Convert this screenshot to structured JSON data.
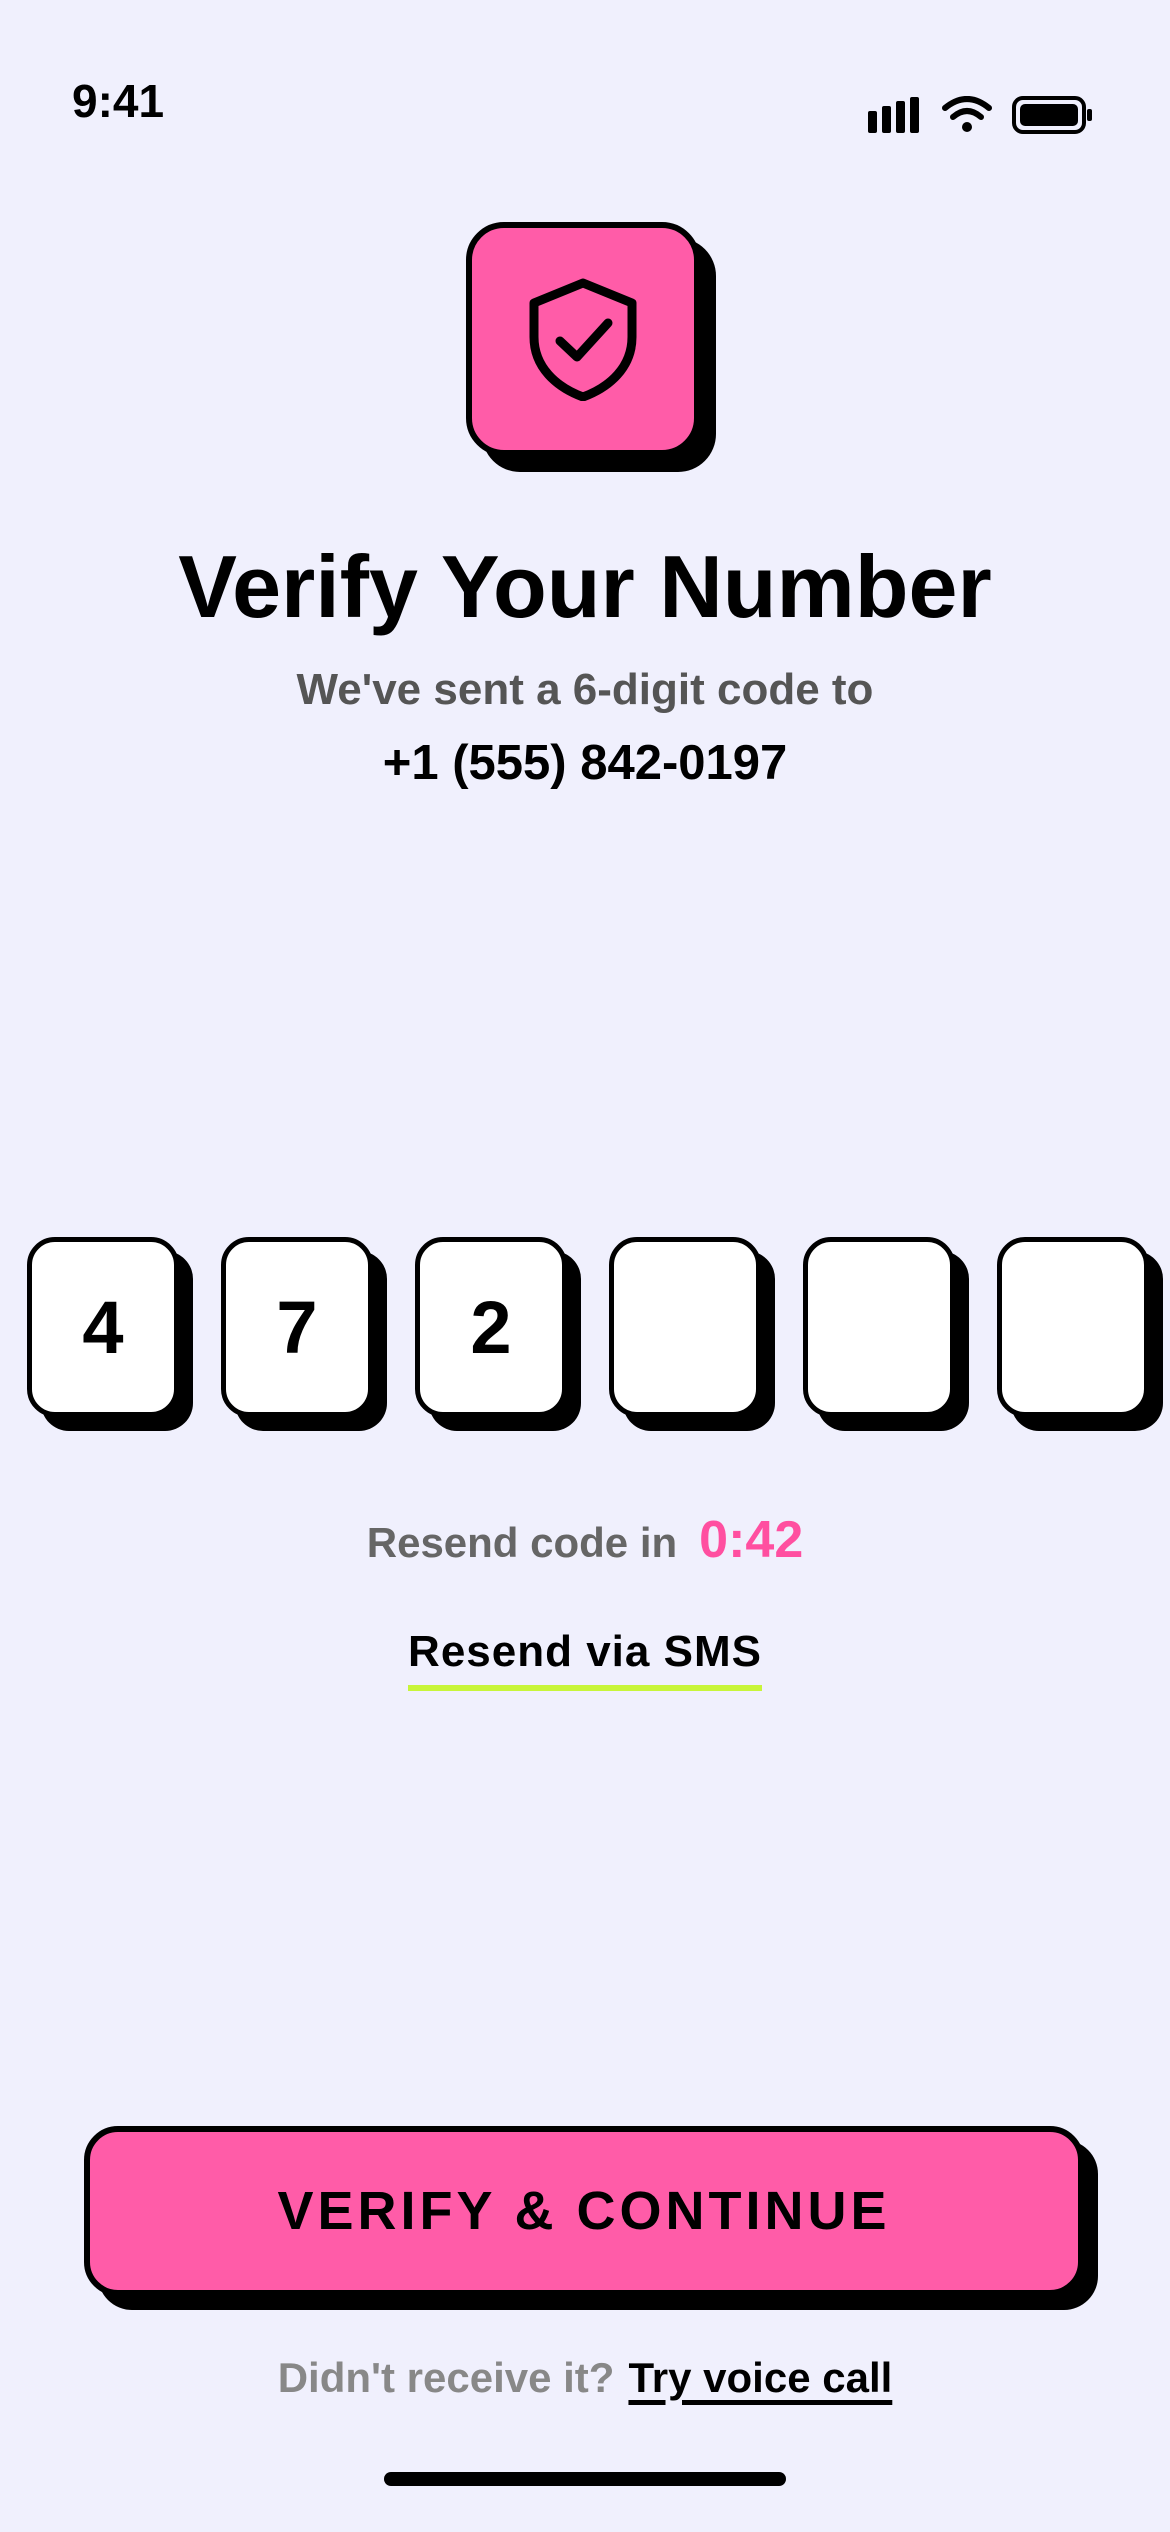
{
  "status_bar": {
    "time": "9:41",
    "icons": [
      "cellular-signal-icon",
      "wifi-icon",
      "battery-icon"
    ]
  },
  "hero": {
    "icon": "shield-check-icon",
    "icon_bg_color": "#ff5ca8"
  },
  "header": {
    "title": "Verify Your Number",
    "subtitle": "We've sent a 6-digit code to",
    "phone": "+1 (555) 842-0197"
  },
  "otp": {
    "digits": [
      "4",
      "7",
      "2",
      "",
      "",
      ""
    ]
  },
  "resend": {
    "label": "Resend code in",
    "timer": "0:42",
    "sms_link": "Resend via SMS"
  },
  "cta": {
    "label": "VERIFY & CONTINUE"
  },
  "footer": {
    "label": "Didn't receive it?",
    "link": "Try voice call"
  },
  "colors": {
    "background": "#f0f0fd",
    "accent_pink": "#ff5ca8",
    "underline_lime": "#c8f53a"
  }
}
